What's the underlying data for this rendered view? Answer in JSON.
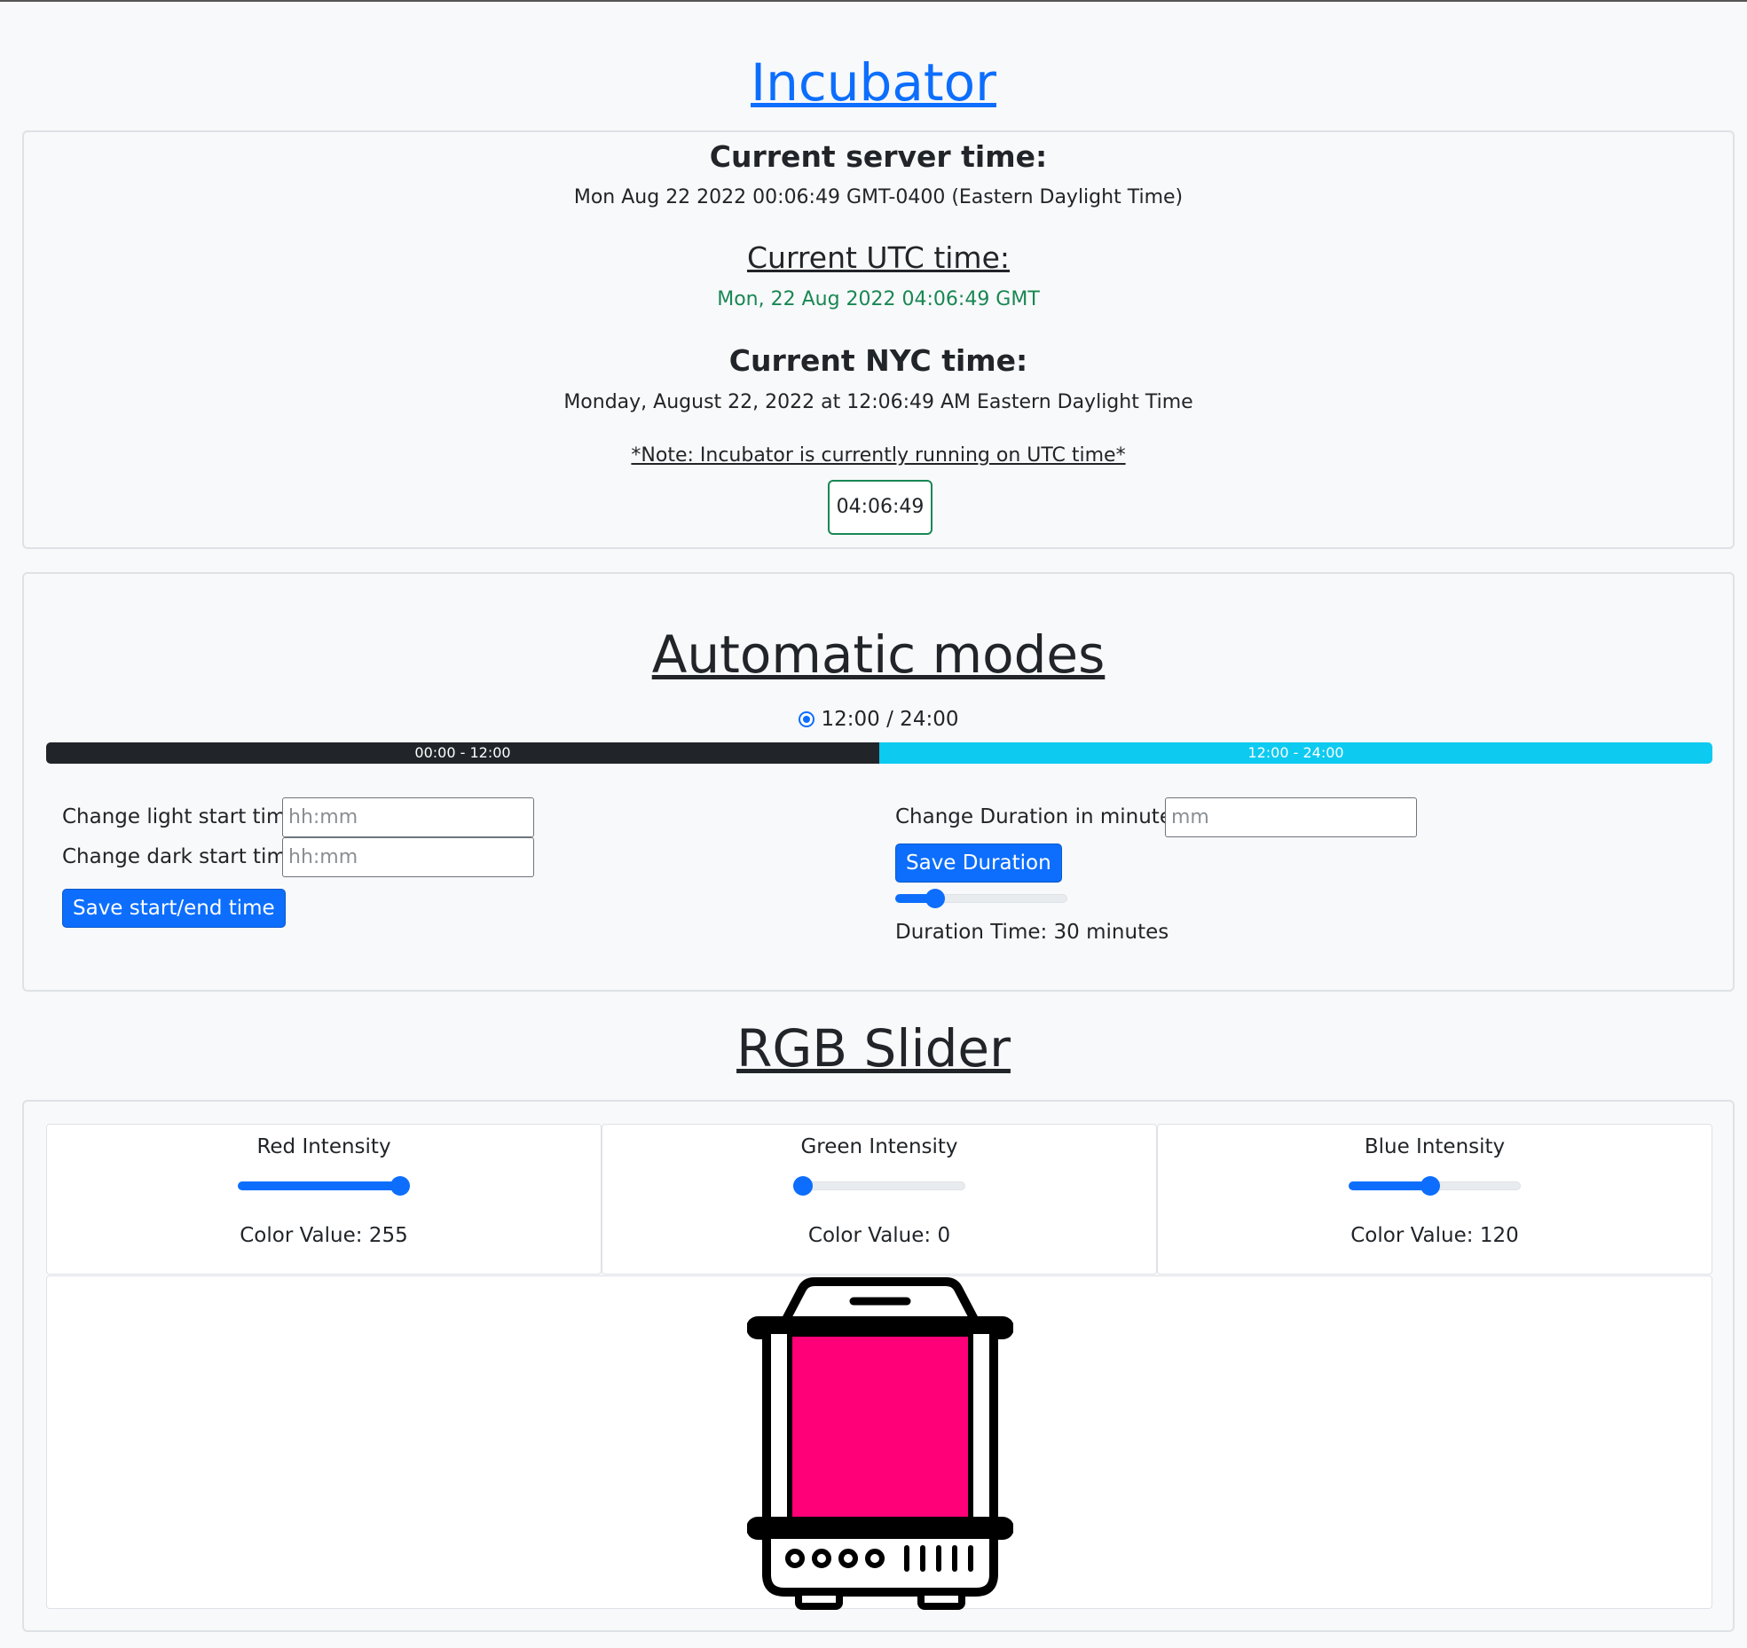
{
  "title": "Incubator",
  "time_card": {
    "server_heading": "Current server time:",
    "server_time": "Mon Aug 22 2022 00:06:49 GMT-0400 (Eastern Daylight Time)",
    "utc_heading": "Current UTC time:",
    "utc_time": "Mon, 22 Aug 2022 04:06:49 GMT",
    "nyc_heading": "Current NYC time:",
    "nyc_time": "Monday, August 22, 2022 at 12:06:49 AM Eastern Daylight Time",
    "note": "*Note: Incubator is currently running on UTC time*",
    "clock": "04:06:49"
  },
  "automatic_modes": {
    "title": "Automatic modes",
    "mode_option": "12:00 / 24:00",
    "progress": [
      {
        "label": "00:00 - 12:00",
        "fraction": 0.5,
        "color": "#212529"
      },
      {
        "label": "12:00 - 24:00",
        "fraction": 0.5,
        "color": "#0dcaf0"
      }
    ],
    "light_label": "Change light start time",
    "light_placeholder": "hh:mm",
    "dark_label": "Change dark start time",
    "dark_placeholder": "hh:mm",
    "save_times_label": "Save start/end time",
    "duration_label": "Change Duration in minutes",
    "duration_placeholder": "mm",
    "save_duration_label": "Save Duration",
    "duration_slider_fraction": 0.2,
    "duration_text": "Duration Time: 30 minutes"
  },
  "rgb": {
    "title": "RGB Slider",
    "channels": [
      {
        "label": "Red Intensity",
        "value_text": "Color Value: 255",
        "value": 255
      },
      {
        "label": "Green Intensity",
        "value_text": "Color Value: 0",
        "value": 0
      },
      {
        "label": "Blue Intensity",
        "value_text": "Color Value: 120",
        "value": 120
      }
    ],
    "preview_color": "#ff0078"
  },
  "colors": {
    "primary": "#0d6efd",
    "success": "#198754",
    "info": "#0dcaf0",
    "dark": "#212529"
  }
}
